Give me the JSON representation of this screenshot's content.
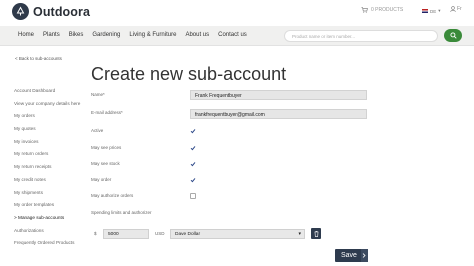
{
  "header": {
    "logo_text": "Outdoora",
    "cart_text": "0 PRODUCTS",
    "language": "DE",
    "user": "Fr"
  },
  "nav": {
    "items": [
      "Home",
      "Plants",
      "Bikes",
      "Gardening",
      "Living & Furniture",
      "About us",
      "Contact us"
    ],
    "search_placeholder": "Product name or item number..."
  },
  "back_link": "< Back to sub-accounts",
  "sidebar": {
    "items": [
      "Account Dashboard",
      "View your company details here",
      "My orders",
      "My quotes",
      "My invoices",
      "My return orders",
      "My return receipts",
      "My credit notes",
      "My shipments",
      "My order templates",
      "> Manage sub-accounts",
      "Authorizations",
      "Frequently Ordered Products"
    ]
  },
  "form": {
    "title": "Create new sub-account",
    "name_label": "Name*",
    "name_value": "Frank Frequentbuyer",
    "email_label": "E-mail address*",
    "email_value": "frankfrequentbuyer@gmail.com",
    "active_label": "Active",
    "see_prices_label": "May see prices",
    "see_stock_label": "May see stock",
    "order_label": "May order",
    "authorize_label": "May authorize orders",
    "limits_label": "Spending limits and authorizer",
    "currency_symbol": "$",
    "limit_value": "5000",
    "currency_code": "USD",
    "authorizer_value": "Dave Dollar",
    "save_label": "Save"
  },
  "colors": {
    "accent_dark": "#2e3b4e",
    "accent_green": "#3a8a3a",
    "check_blue": "#2f4a8a"
  }
}
